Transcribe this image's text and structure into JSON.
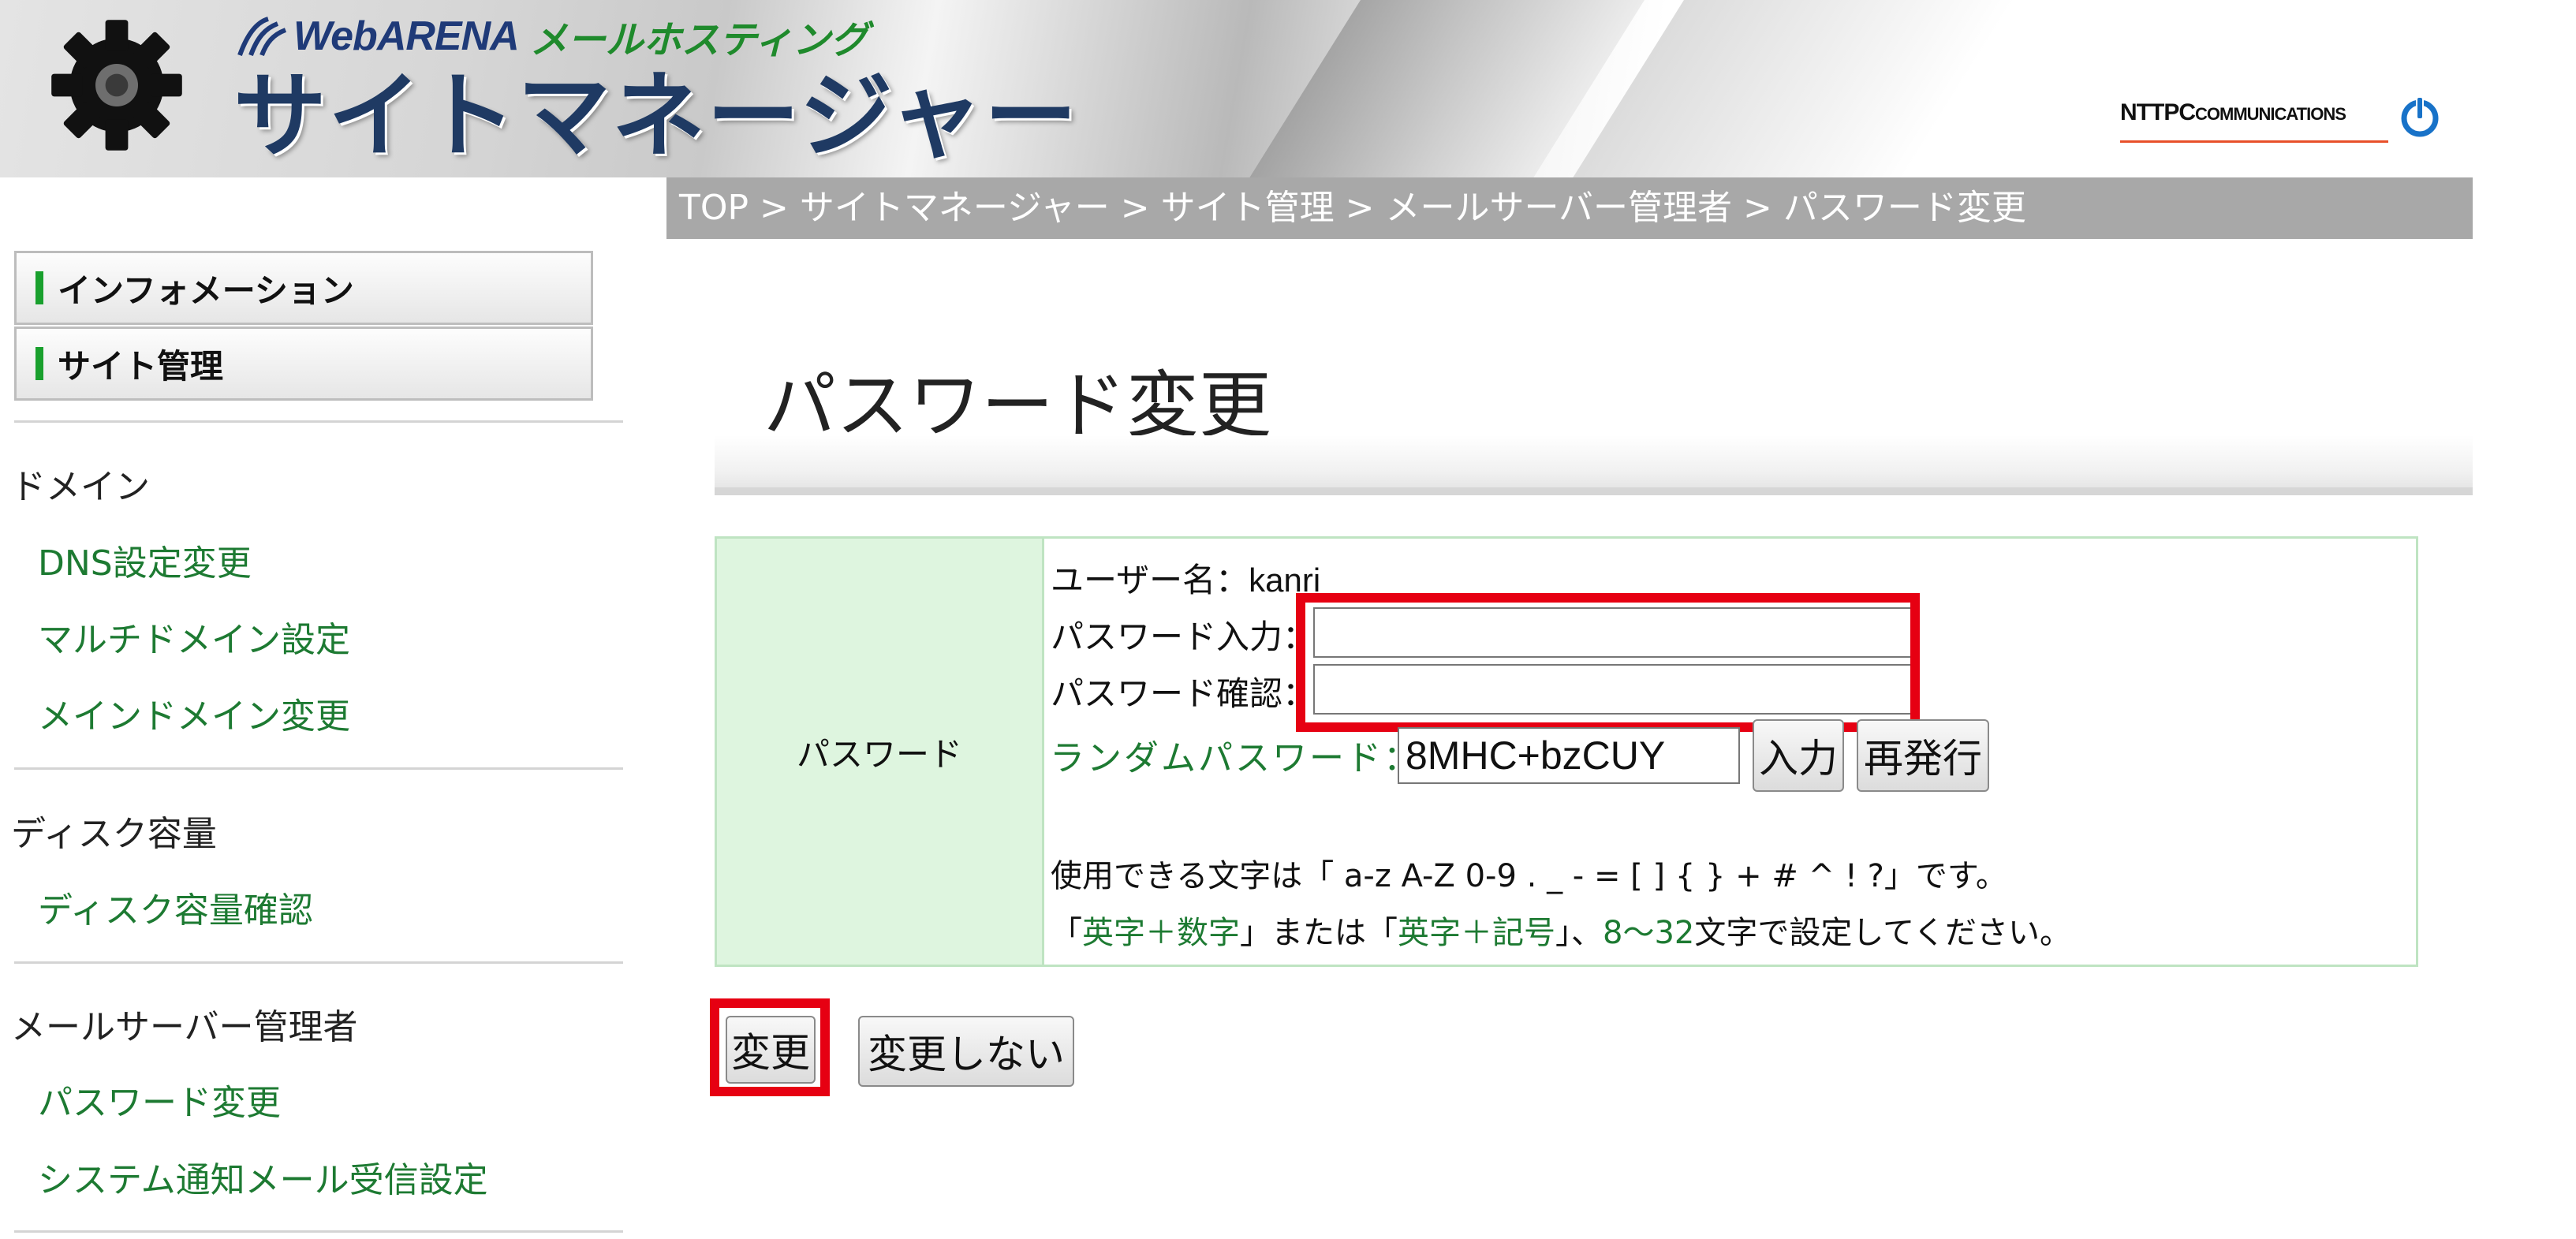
{
  "header": {
    "brand_webarena": "WebARENA",
    "brand_hosting": "メールホスティング",
    "brand_main": "サイトマネージャー",
    "ntt_logo_main": "NTTPC",
    "ntt_logo_sub": "COMMUNICATIONS"
  },
  "breadcrumb": "TOP > サイトマネージャー > サイト管理 > メールサーバー管理者 > パスワード変更",
  "sidebar": {
    "buttons": [
      {
        "label": "インフォメーション"
      },
      {
        "label": "サイト管理"
      }
    ],
    "sections": [
      {
        "heading": "ドメイン",
        "links": [
          "DNS設定変更",
          "マルチドメイン設定",
          "メインドメイン変更"
        ]
      },
      {
        "heading": "ディスク容量",
        "links": [
          "ディスク容量確認"
        ]
      },
      {
        "heading": "メールサーバー管理者",
        "links": [
          "パスワード変更",
          "システム通知メール受信設定"
        ]
      }
    ]
  },
  "main": {
    "title": "パスワード変更",
    "form": {
      "row_label": "パスワード",
      "username_label": "ユーザー名：",
      "username_value": "kanri",
      "password_label": "パスワード入力：",
      "password_value": "",
      "confirm_label": "パスワード確認：",
      "confirm_value": "",
      "random_label": "ランダムパスワード：",
      "random_value": "8MHC+bzCUY",
      "input_button": "入力",
      "regenerate_button": "再発行",
      "note_line1": "使用できる文字は「 a-z A-Z 0-9 . _ - = [ ] { } + # ^ ! ?」です。",
      "note_line2": {
        "open1": "「",
        "alnum": "英字＋数字",
        "mid": "」または「",
        "alsym": "英字＋記号",
        "close": "」、",
        "range": "8～32",
        "tail": "文字で設定してください。"
      }
    },
    "change_button": "変更",
    "no_change_button": "変更しない"
  },
  "colors": {
    "link_green": "#1d7a32",
    "highlight_red": "#e60012",
    "label_cell_bg": "#def5df",
    "breadcrumb_bg": "#a8a8a8"
  }
}
